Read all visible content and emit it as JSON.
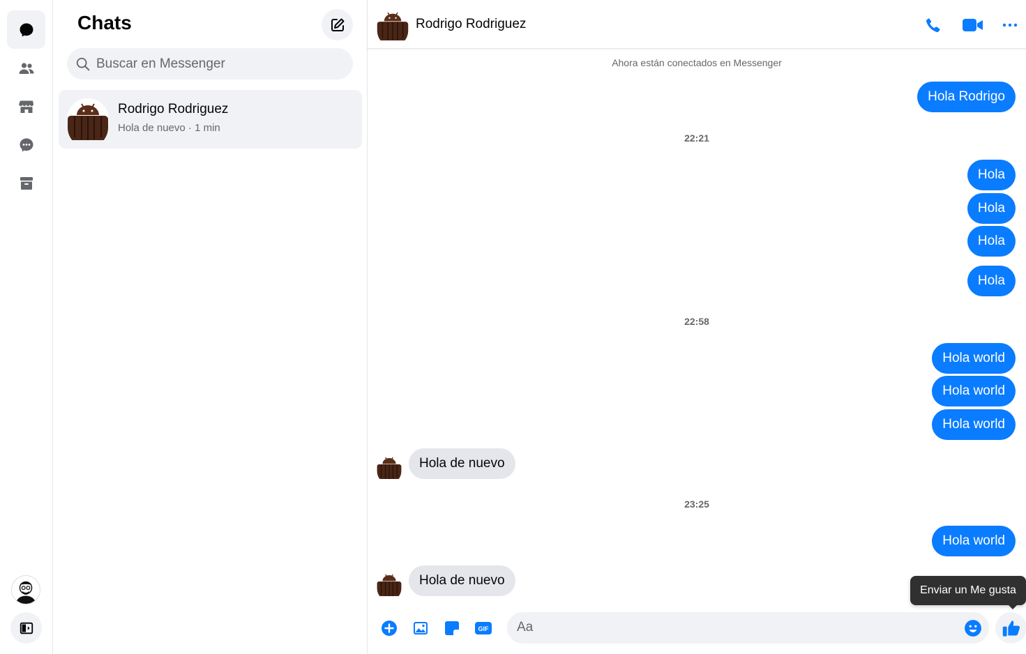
{
  "rail": {
    "items": [
      {
        "name": "chats-icon",
        "active": true
      },
      {
        "name": "people-icon",
        "active": false
      },
      {
        "name": "marketplace-icon",
        "active": false
      },
      {
        "name": "requests-icon",
        "active": false
      },
      {
        "name": "archive-icon",
        "active": false
      }
    ]
  },
  "list": {
    "title": "Chats",
    "search_placeholder": "Buscar en Messenger",
    "conversations": [
      {
        "name": "Rodrigo Rodriguez",
        "snippet": "Hola de nuevo",
        "time": "1 min"
      }
    ]
  },
  "chat": {
    "contact_name": "Rodrigo Rodriguez",
    "system_note": "Ahora están conectados en Messenger",
    "messages": [
      {
        "dir": "out",
        "text": "Hola Rodrigo"
      },
      {
        "time": "22:21"
      },
      {
        "dir": "out",
        "text": "Hola"
      },
      {
        "dir": "out",
        "text": "Hola"
      },
      {
        "dir": "out",
        "text": "Hola"
      },
      {
        "dir": "out",
        "text": "Hola"
      },
      {
        "time": "22:58"
      },
      {
        "dir": "out",
        "text": "Hola world"
      },
      {
        "dir": "out",
        "text": "Hola world"
      },
      {
        "dir": "out",
        "text": "Hola world"
      },
      {
        "dir": "in",
        "text": "Hola de nuevo"
      },
      {
        "time": "23:25"
      },
      {
        "dir": "out",
        "text": "Hola world"
      },
      {
        "dir": "in",
        "text": "Hola de nuevo"
      }
    ],
    "tooltip": "Enviar un Me gusta",
    "composer_placeholder": "Aa",
    "composer_icons": [
      "add-icon",
      "photo-icon",
      "sticker-icon",
      "gif-icon",
      "emoji-icon",
      "like-icon"
    ],
    "gif_label": "GIF"
  },
  "colors": {
    "accent": "#0a7cff",
    "bubble_in": "#e4e6eb",
    "surface": "#f0f2f5"
  }
}
